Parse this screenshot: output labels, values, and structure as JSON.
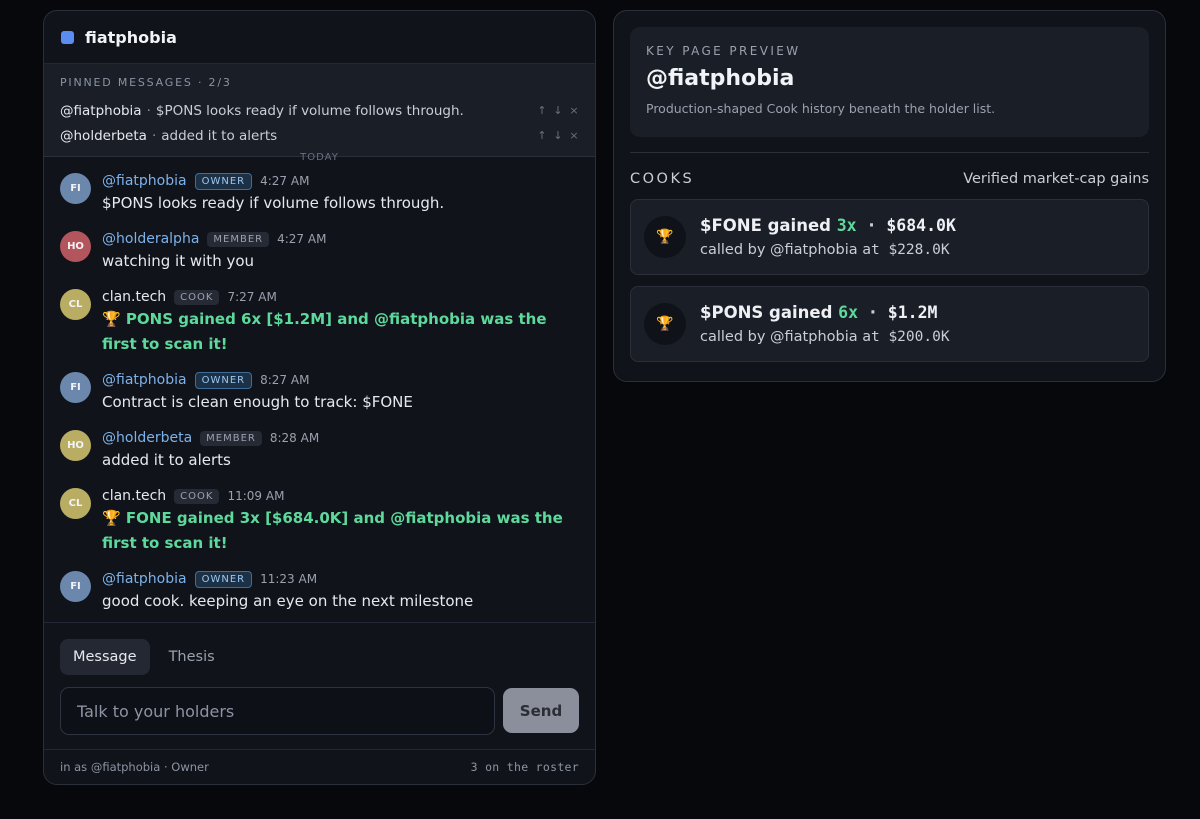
{
  "channel": {
    "name": "fiatphobia",
    "accent": "#5b8df0"
  },
  "pinned": {
    "title": "PINNED MESSAGES · 2/3",
    "items": [
      {
        "author": "@fiatphobia",
        "text": "$PONS looks ready if volume follows through."
      },
      {
        "author": "@holderbeta",
        "text": "added it to alerts"
      }
    ],
    "controls": {
      "up": "↑",
      "down": "↓",
      "close": "×"
    },
    "peek": "TODAY"
  },
  "messages": [
    {
      "initials": "FI",
      "avatar_color": "#6b87ab",
      "author": "@fiatphobia",
      "badge": "OWNER",
      "time": "4:27 AM",
      "text": "$PONS looks ready if volume follows through."
    },
    {
      "initials": "HO",
      "avatar_color": "#b2555c",
      "author": "@holderalpha",
      "badge": "MEMBER",
      "time": "4:27 AM",
      "text": "watching it with you"
    },
    {
      "initials": "CL",
      "avatar_color": "#b9ad63",
      "author": "clan.tech",
      "badge": "COOK",
      "time": "7:27 AM",
      "text": "🏆 PONS gained 6x [$1.2M] and @fiatphobia was the first to scan it!"
    },
    {
      "initials": "FI",
      "avatar_color": "#6b87ab",
      "author": "@fiatphobia",
      "badge": "OWNER",
      "time": "8:27 AM",
      "text": "Contract is clean enough to track: $FONE"
    },
    {
      "initials": "HO",
      "avatar_color": "#b9ad63",
      "author": "@holderbeta",
      "badge": "MEMBER",
      "time": "8:28 AM",
      "text": "added it to alerts"
    },
    {
      "initials": "CL",
      "avatar_color": "#b9ad63",
      "author": "clan.tech",
      "badge": "COOK",
      "time": "11:09 AM",
      "text": "🏆 FONE gained 3x [$684.0K] and @fiatphobia was the first to scan it!"
    },
    {
      "initials": "FI",
      "avatar_color": "#6b87ab",
      "author": "@fiatphobia",
      "badge": "OWNER",
      "time": "11:23 AM",
      "text": "good cook. keeping an eye on the next milestone"
    }
  ],
  "composer": {
    "tabs": [
      "Message",
      "Thesis"
    ],
    "placeholder": "Talk to your holders",
    "send_label": "Send"
  },
  "footer": {
    "signed_in": "in as @fiatphobia · Owner",
    "roster": "3 on the roster"
  },
  "preview": {
    "kicker": "KEY PAGE PREVIEW",
    "title": "@fiatphobia",
    "subtitle": "Production-shaped Cook history beneath the holder list.",
    "cooks_title": "COOKS",
    "cooks_subtitle": "Verified market-cap gains",
    "cooks": [
      {
        "token": "$FONE gained",
        "multiple": "3x",
        "dot": "·",
        "mcap": "$684.0K",
        "called": "called by @fiatphobia",
        "at": "at $228.0K"
      },
      {
        "token": "$PONS gained",
        "multiple": "6x",
        "dot": "·",
        "mcap": "$1.2M",
        "called": "called by @fiatphobia",
        "at": "at $200.0K"
      }
    ],
    "trophy_icon": "🏆"
  }
}
